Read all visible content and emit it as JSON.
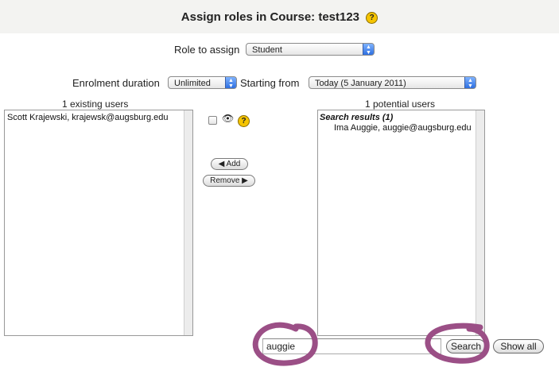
{
  "header": {
    "title": "Assign roles in Course: test123"
  },
  "role": {
    "label": "Role to assign",
    "value": "Student"
  },
  "enrolment": {
    "duration_label": "Enrolment duration",
    "duration_value": "Unlimited",
    "start_label": "Starting from",
    "start_value": "Today (5 January 2011)"
  },
  "existing": {
    "header": "1 existing users",
    "items": [
      "Scott Krajewski, krajewsk@augsburg.edu"
    ]
  },
  "potential": {
    "header": "1 potential users",
    "group_label": "Search results (1)",
    "items": [
      "Ima Auggie, auggie@augsburg.edu"
    ]
  },
  "controls": {
    "add_label": "◀ Add",
    "remove_label": "Remove ▶",
    "eye_glyph": "👁",
    "help_glyph": "?"
  },
  "search": {
    "value": "auggie",
    "button_label": "Search",
    "show_all_label": "Show all"
  },
  "colors": {
    "annotation": "#9b4f86",
    "select_arrow": "#2e6fe0",
    "help": "#f5c400"
  }
}
